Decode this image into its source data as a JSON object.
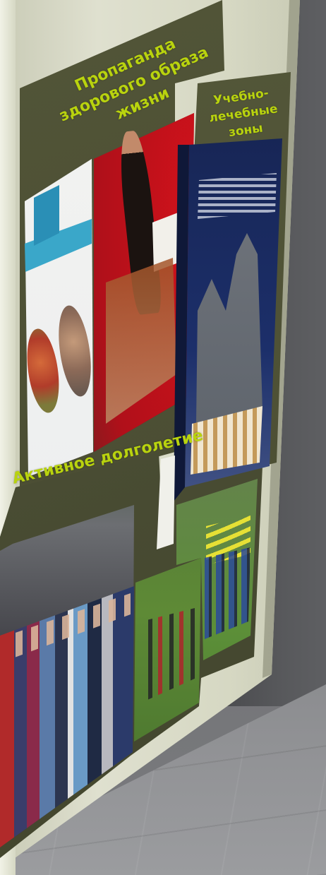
{
  "scene": {
    "description_type": "photo",
    "colors": {
      "panel": "#4c4f37",
      "heading_text": "#b9d30e",
      "stand": "#dfe0cf",
      "wall": "#58595c",
      "floor": "#9b9c9f"
    }
  },
  "stand": {
    "headings": {
      "healthy_lifestyle": "Пропаганда здорового образа жизни",
      "health_resorts": "Учебно-лечебные зоны",
      "active_longevity": "Активное долголетие"
    }
  }
}
